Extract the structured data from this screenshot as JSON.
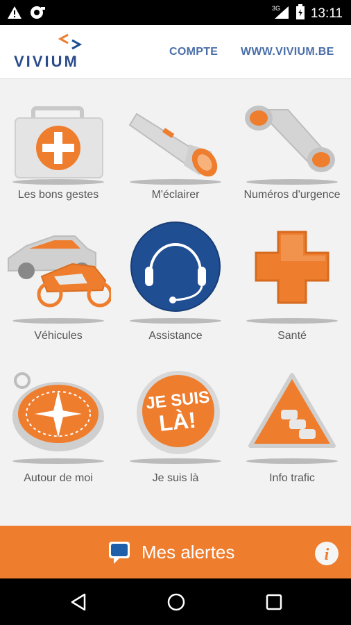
{
  "status_bar": {
    "time": "13:11",
    "network": "3G"
  },
  "header": {
    "logo_text": "VIVIUM",
    "links": [
      "COMPTE",
      "WWW.VIVIUM.BE"
    ]
  },
  "tiles": [
    {
      "label": "Les bons gestes",
      "icon": "first-aid-kit-icon"
    },
    {
      "label": "M'éclairer",
      "icon": "flashlight-icon"
    },
    {
      "label": "Numéros d'urgence",
      "icon": "phone-handset-icon"
    },
    {
      "label": "Véhicules",
      "icon": "vehicles-icon"
    },
    {
      "label": "Assistance",
      "icon": "headset-icon"
    },
    {
      "label": "Santé",
      "icon": "medical-cross-icon"
    },
    {
      "label": "Autour de moi",
      "icon": "compass-icon"
    },
    {
      "label": "Je suis là",
      "icon": "je-suis-la-badge-icon",
      "badge_text": [
        "JE SUIS",
        "LÀ!"
      ]
    },
    {
      "label": "Info trafic",
      "icon": "traffic-sign-icon"
    }
  ],
  "alerts": {
    "label": "Mes alertes"
  },
  "colors": {
    "accent": "#ee7d2e",
    "brand_blue": "#1f4e93",
    "header_link": "#4a6ea8"
  }
}
